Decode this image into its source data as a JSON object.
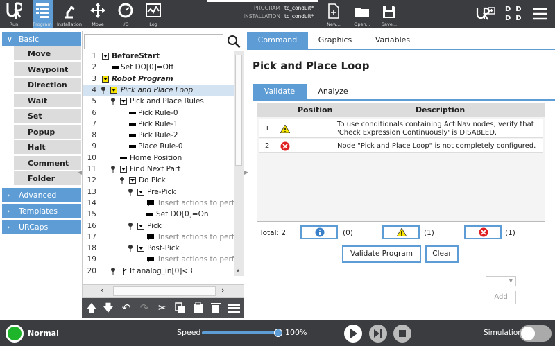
{
  "topbar": {
    "nav": [
      {
        "label": "Run"
      },
      {
        "label": "Program"
      },
      {
        "label": "Installation"
      },
      {
        "label": "Move"
      },
      {
        "label": "I/O"
      },
      {
        "label": "Log"
      }
    ],
    "program_label": "PROGRAM",
    "program_value": "tc_conduit*",
    "installation_label": "INSTALLATION",
    "installation_value": "tc_conduit*",
    "file_buttons": [
      {
        "label": "New..."
      },
      {
        "label": "Open..."
      },
      {
        "label": "Save..."
      }
    ],
    "mode_letters": [
      "D",
      "D",
      "D",
      "D"
    ]
  },
  "left_panel": {
    "basic_label": "Basic",
    "basic_items": [
      "Move",
      "Waypoint",
      "Direction",
      "Wait",
      "Set",
      "Popup",
      "Halt",
      "Comment",
      "Folder"
    ],
    "advanced_label": "Advanced",
    "templates_label": "Templates",
    "urcaps_label": "URCaps"
  },
  "tree": {
    "rows": [
      {
        "num": "1",
        "text": "BeforeStart"
      },
      {
        "num": "2",
        "text": "Set DO[0]=Off"
      },
      {
        "num": "3",
        "text": "Robot Program"
      },
      {
        "num": "4",
        "text": "Pick and Place Loop"
      },
      {
        "num": "5",
        "text": "Pick and Place Rules"
      },
      {
        "num": "6",
        "text": "Pick Rule-0"
      },
      {
        "num": "7",
        "text": "Pick Rule-1"
      },
      {
        "num": "8",
        "text": "Pick Rule-2"
      },
      {
        "num": "9",
        "text": "Place Rule-0"
      },
      {
        "num": "10",
        "text": "Home Position"
      },
      {
        "num": "11",
        "text": "Find Next Part"
      },
      {
        "num": "12",
        "text": "Do Pick"
      },
      {
        "num": "13",
        "text": "Pre-Pick"
      },
      {
        "num": "14",
        "text": "'Insert actions to perfo"
      },
      {
        "num": "15",
        "text": "Set DO[0]=On"
      },
      {
        "num": "16",
        "text": "Pick"
      },
      {
        "num": "17",
        "text": "'Insert actions to perfo"
      },
      {
        "num": "18",
        "text": "Post-Pick"
      },
      {
        "num": "19",
        "text": "'Insert actions to perfo"
      },
      {
        "num": "20",
        "text": "If analog_in[0]<3"
      }
    ]
  },
  "main": {
    "tabs": [
      "Command",
      "Graphics",
      "Variables"
    ],
    "title": "Pick and Place Loop",
    "subtabs": [
      "Validate",
      "Analyze"
    ],
    "table": {
      "col_position": "Position",
      "col_description": "Description",
      "rows": [
        {
          "num": "1",
          "description": "To use conditionals containing ActiNav nodes, verify that 'Check Expression Continuously' is DISABLED."
        },
        {
          "num": "2",
          "description": "Node \"Pick and Place Loop\" is not completely configured."
        }
      ]
    },
    "total_label": "Total: 2",
    "info_count": "(0)",
    "warning_count": "(1)",
    "error_count": "(1)",
    "validate_button": "Validate Program",
    "clear_button": "Clear",
    "add_button": "Add"
  },
  "footer": {
    "status": "Normal",
    "speed_label": "Speed",
    "speed_value": "100%",
    "speed_fraction": 1.0,
    "simulation_label": "Simulation"
  },
  "colors": {
    "accent": "#5d9cd4",
    "topbar": "#3a3c3f",
    "status_green": "#1fb52a",
    "warning": "#f6e400",
    "error": "#e02020"
  }
}
